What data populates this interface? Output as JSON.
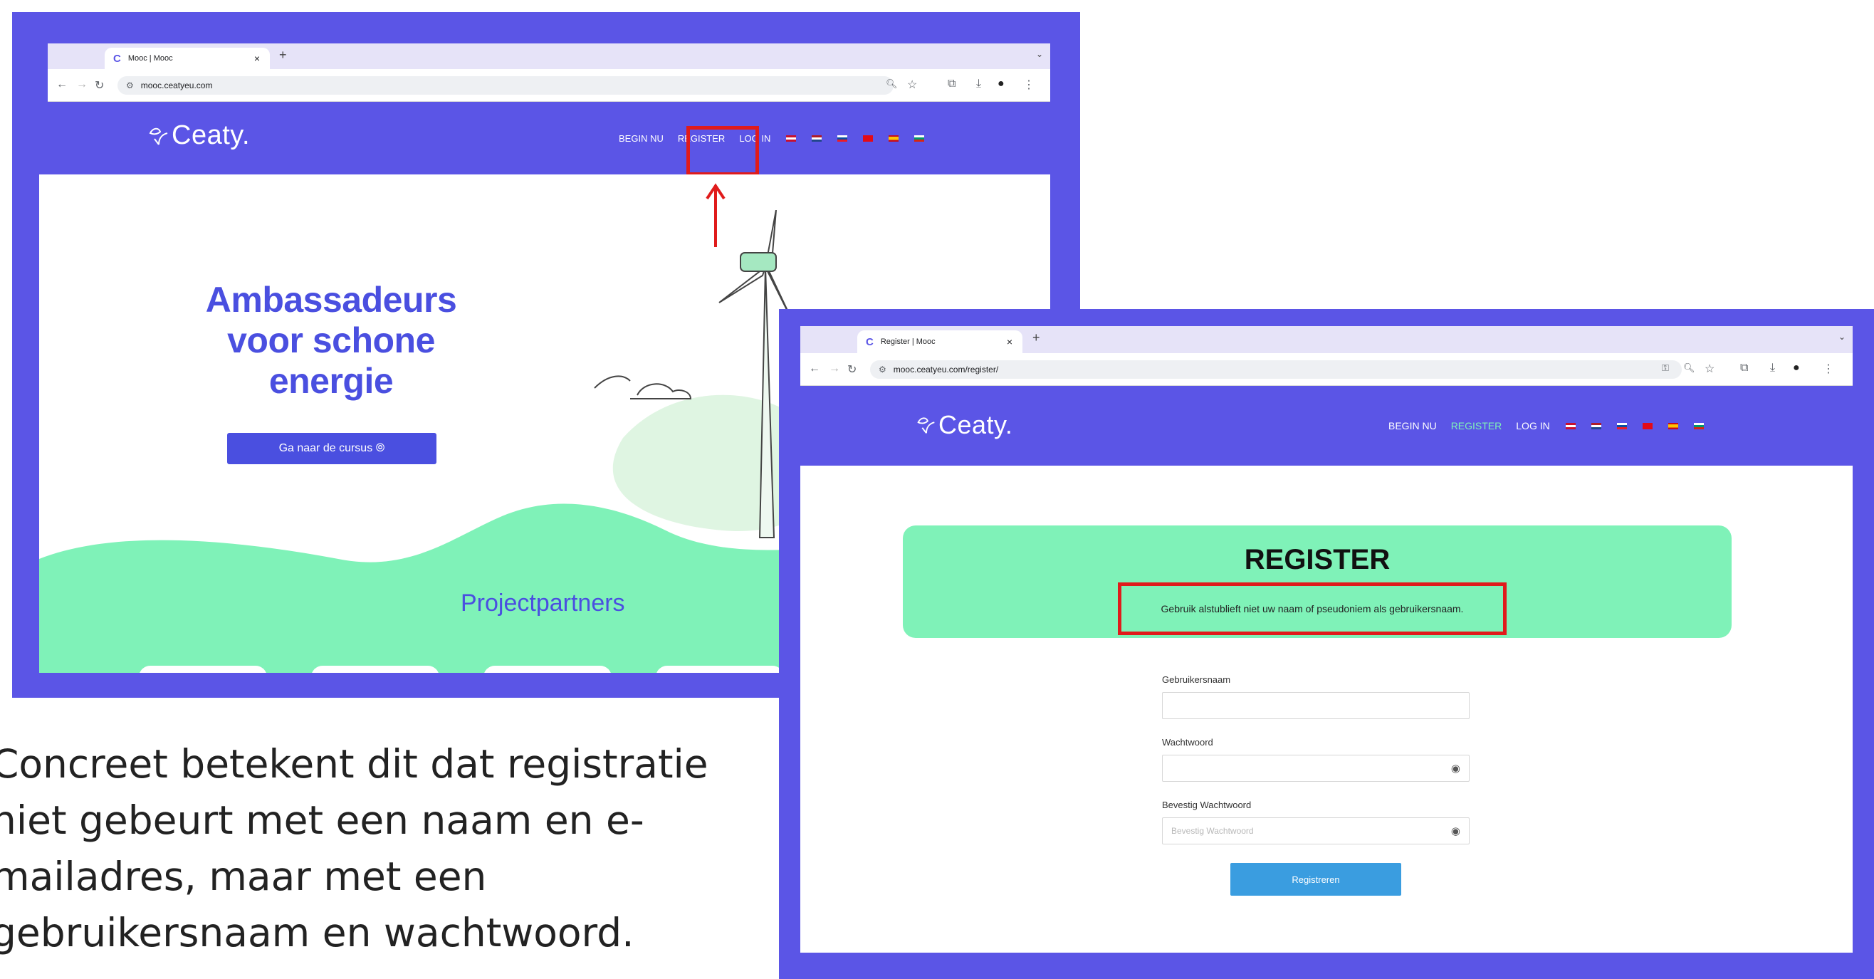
{
  "screenshot1": {
    "tab_title": "Mooc | Mooc",
    "url": "mooc.ceatyeu.com",
    "logo_text": "Ceaty.",
    "nav": {
      "begin": "BEGIN NU",
      "register": "REGISTER",
      "login": "LOG IN"
    },
    "hero_title": [
      "Ambassadeurs",
      "voor schone",
      "energie"
    ],
    "hero_button": "Ga naar de cursus ⦾",
    "partners_heading": "Projectpartners"
  },
  "screenshot2": {
    "tab_title": "Register | Mooc",
    "url": "mooc.ceatyeu.com/register/",
    "logo_text": "Ceaty.",
    "nav": {
      "begin": "BEGIN NU",
      "register": "REGISTER",
      "login": "LOG IN"
    },
    "register_title": "REGISTER",
    "notice": "Gebruik alstublieft niet uw naam of pseudoniem als gebruikersnaam.",
    "fields": {
      "username_label": "Gebruikersnaam",
      "password_label": "Wachtwoord",
      "confirm_label": "Bevestig Wachtwoord",
      "confirm_placeholder": "Bevestig Wachtwoord"
    },
    "submit": "Registreren"
  },
  "caption": [
    "Concreet betekent dit dat registratie",
    "niet gebeurt met een naam en e-",
    "mailadres, maar met een",
    "gebruikersnaam en wachtwoord."
  ],
  "colors": {
    "brand_purple": "#5b55e6",
    "mint": "#7ff2b8",
    "highlight_red": "#e01b1b",
    "register_active": "#7ff2b8",
    "button_blue": "#3a9de0",
    "hero_title": "#4a4fe0"
  },
  "icons": [
    "back-arrow-icon",
    "forward-arrow-icon",
    "reload-icon",
    "site-settings-icon",
    "zoom-icon",
    "star-icon",
    "extensions-icon",
    "download-icon",
    "profile-icon",
    "menu-dots-icon",
    "eye-icon",
    "leaf-logo-icon",
    "wind-turbine-illustration",
    "cloud-icon",
    "red-arrow-up"
  ]
}
